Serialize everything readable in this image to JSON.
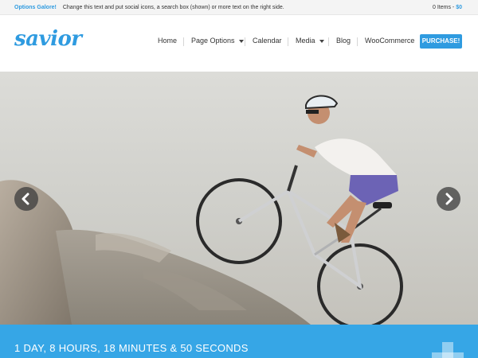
{
  "topbar": {
    "promo_title": "Options Galore!",
    "promo_text": "Change this text and put social icons, a search box (shown) or more text on the right side.",
    "cart_items": "0 Items -",
    "cart_price": "$0"
  },
  "header": {
    "logo": "savior",
    "nav": [
      {
        "label": "Home"
      },
      {
        "label": "Page Options",
        "dropdown": true
      },
      {
        "label": "Calendar"
      },
      {
        "label": "Media",
        "dropdown": true
      },
      {
        "label": "Blog"
      },
      {
        "label": "WooCommerce"
      }
    ],
    "purchase_label": "PURCHASE!"
  },
  "slider": {
    "prev_icon": "chevron-left-icon",
    "next_icon": "chevron-right-icon"
  },
  "countdown": {
    "text": "1 DAY, 8 HOURS, 18 MINUTES & 50 SECONDS",
    "icon": "plus-icon"
  },
  "colors": {
    "accent": "#2f9be0",
    "band": "#36a6e6"
  }
}
